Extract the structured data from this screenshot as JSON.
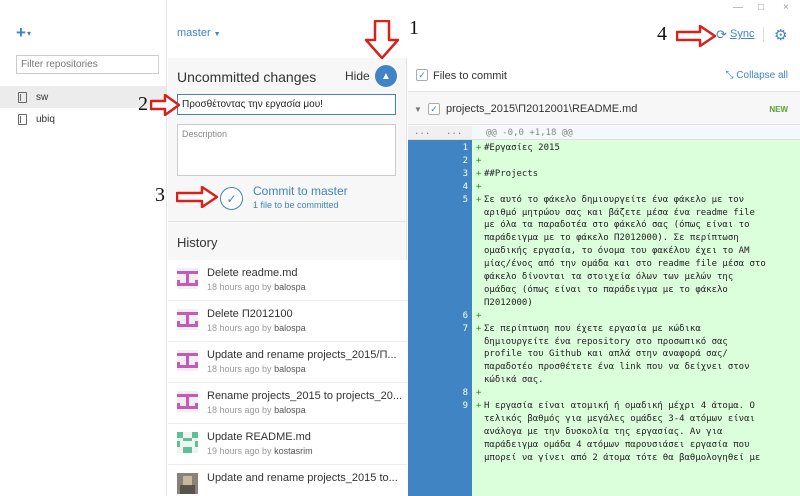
{
  "window": {
    "minimize": "—",
    "maximize": "□",
    "close": "×"
  },
  "sidebar": {
    "add_button": "+",
    "filter_placeholder": "Filter repositories",
    "repos": [
      {
        "name": "sw",
        "selected": true
      },
      {
        "name": "ubiq",
        "selected": false
      }
    ]
  },
  "topbar": {
    "branch": "master",
    "sync_label": "Sync",
    "sync_icon": "refresh-icon",
    "settings_icon": "gear-icon"
  },
  "changes": {
    "title": "Uncommitted changes",
    "hide_label": "Hide",
    "summary_value": "Προσθέτοντας την εργασία μου!",
    "description_placeholder": "Description",
    "commit_label": "Commit to master",
    "commit_sub": "1 file to be committed"
  },
  "history": {
    "title": "History",
    "items": [
      {
        "title": "Delete readme.md",
        "time": "18 hours ago by",
        "author": "balospa"
      },
      {
        "title": "Delete Π2012100",
        "time": "18 hours ago by",
        "author": "balospa"
      },
      {
        "title": "Update and rename projects_2015/Π...",
        "time": "18 hours ago by",
        "author": "balospa"
      },
      {
        "title": "Rename projects_2015 to projects_20...",
        "time": "18 hours ago by",
        "author": "balospa"
      },
      {
        "title": "Update README.md",
        "time": "19 hours ago by",
        "author": "kostasrim"
      },
      {
        "title": "Update and rename projects_2015 to...",
        "time": "",
        "author": ""
      }
    ]
  },
  "files": {
    "header_label": "Files to commit",
    "collapse_label": "Collapse all",
    "file_name": "projects_2015\\Π2012001\\README.md",
    "badge": "NEW"
  },
  "diff": {
    "gutter_old": "...",
    "gutter_new": "...",
    "hunk": "@@ -0,0 +1,18 @@",
    "lines": [
      {
        "num": "1",
        "text": "#Εργασίες 2015"
      },
      {
        "num": "2",
        "text": ""
      },
      {
        "num": "3",
        "text": "##Projects"
      },
      {
        "num": "4",
        "text": ""
      },
      {
        "num": "5",
        "text": "Σε αυτό το φάκελο δημιουργείτε ένα φάκελο με τον"
      },
      {
        "num": "",
        "text": "αριθμό μητρώου σας και βάζετε μέσα ένα readme file"
      },
      {
        "num": "",
        "text": "με όλα τα παραδοτέα στο φάκελό σας (όπως είναι το"
      },
      {
        "num": "",
        "text": "παράδειγμα με το φάκελο Π2012000). Σε περίπτωση"
      },
      {
        "num": "",
        "text": "ομαδικής εργασία, το όνομα του φακέλου έχει το ΑΜ"
      },
      {
        "num": "",
        "text": "μίας/ένος από την ομάδα και στο readme file μέσα στο"
      },
      {
        "num": "",
        "text": "φάκελο δίνονται τα στοιχεία όλων των μελών της"
      },
      {
        "num": "",
        "text": "ομάδας (όπως είναι το παράδειγμα με το φάκελο"
      },
      {
        "num": "",
        "text": "Π2012000)"
      },
      {
        "num": "6",
        "text": ""
      },
      {
        "num": "7",
        "text": "Σε περίπτωση που έχετε εργασία με κώδικα"
      },
      {
        "num": "",
        "text": "δημιουργείτε ένα repository στο προσωπικό σας"
      },
      {
        "num": "",
        "text": "profile του Github και απλά στην αναφορά σας/"
      },
      {
        "num": "",
        "text": "παραδοτέο προσθέτετε ένα link που να δείχνει στον"
      },
      {
        "num": "",
        "text": "κώδικά σας."
      },
      {
        "num": "8",
        "text": ""
      },
      {
        "num": "9",
        "text": "Η εργασία είναι ατομική ή ομαδική μέχρι 4 άτομα. Ο"
      },
      {
        "num": "",
        "text": "τελικός βαθμός για μεγάλες ομάδες 3-4 ατόμων είναι"
      },
      {
        "num": "",
        "text": "ανάλογα με την δυσκολία της εργασίας. Αν για"
      },
      {
        "num": "",
        "text": "παράδειγμα ομάδα 4 ατόμων παρουσιάσει εργασία που"
      },
      {
        "num": "",
        "text": "μπορεί να γίνει από 2 άτομα τότε θα βαθμολογηθεί με"
      }
    ]
  },
  "annotations": {
    "n1": "1",
    "n2": "2",
    "n3": "3",
    "n4": "4",
    "arrow_color": "#d9201a"
  }
}
